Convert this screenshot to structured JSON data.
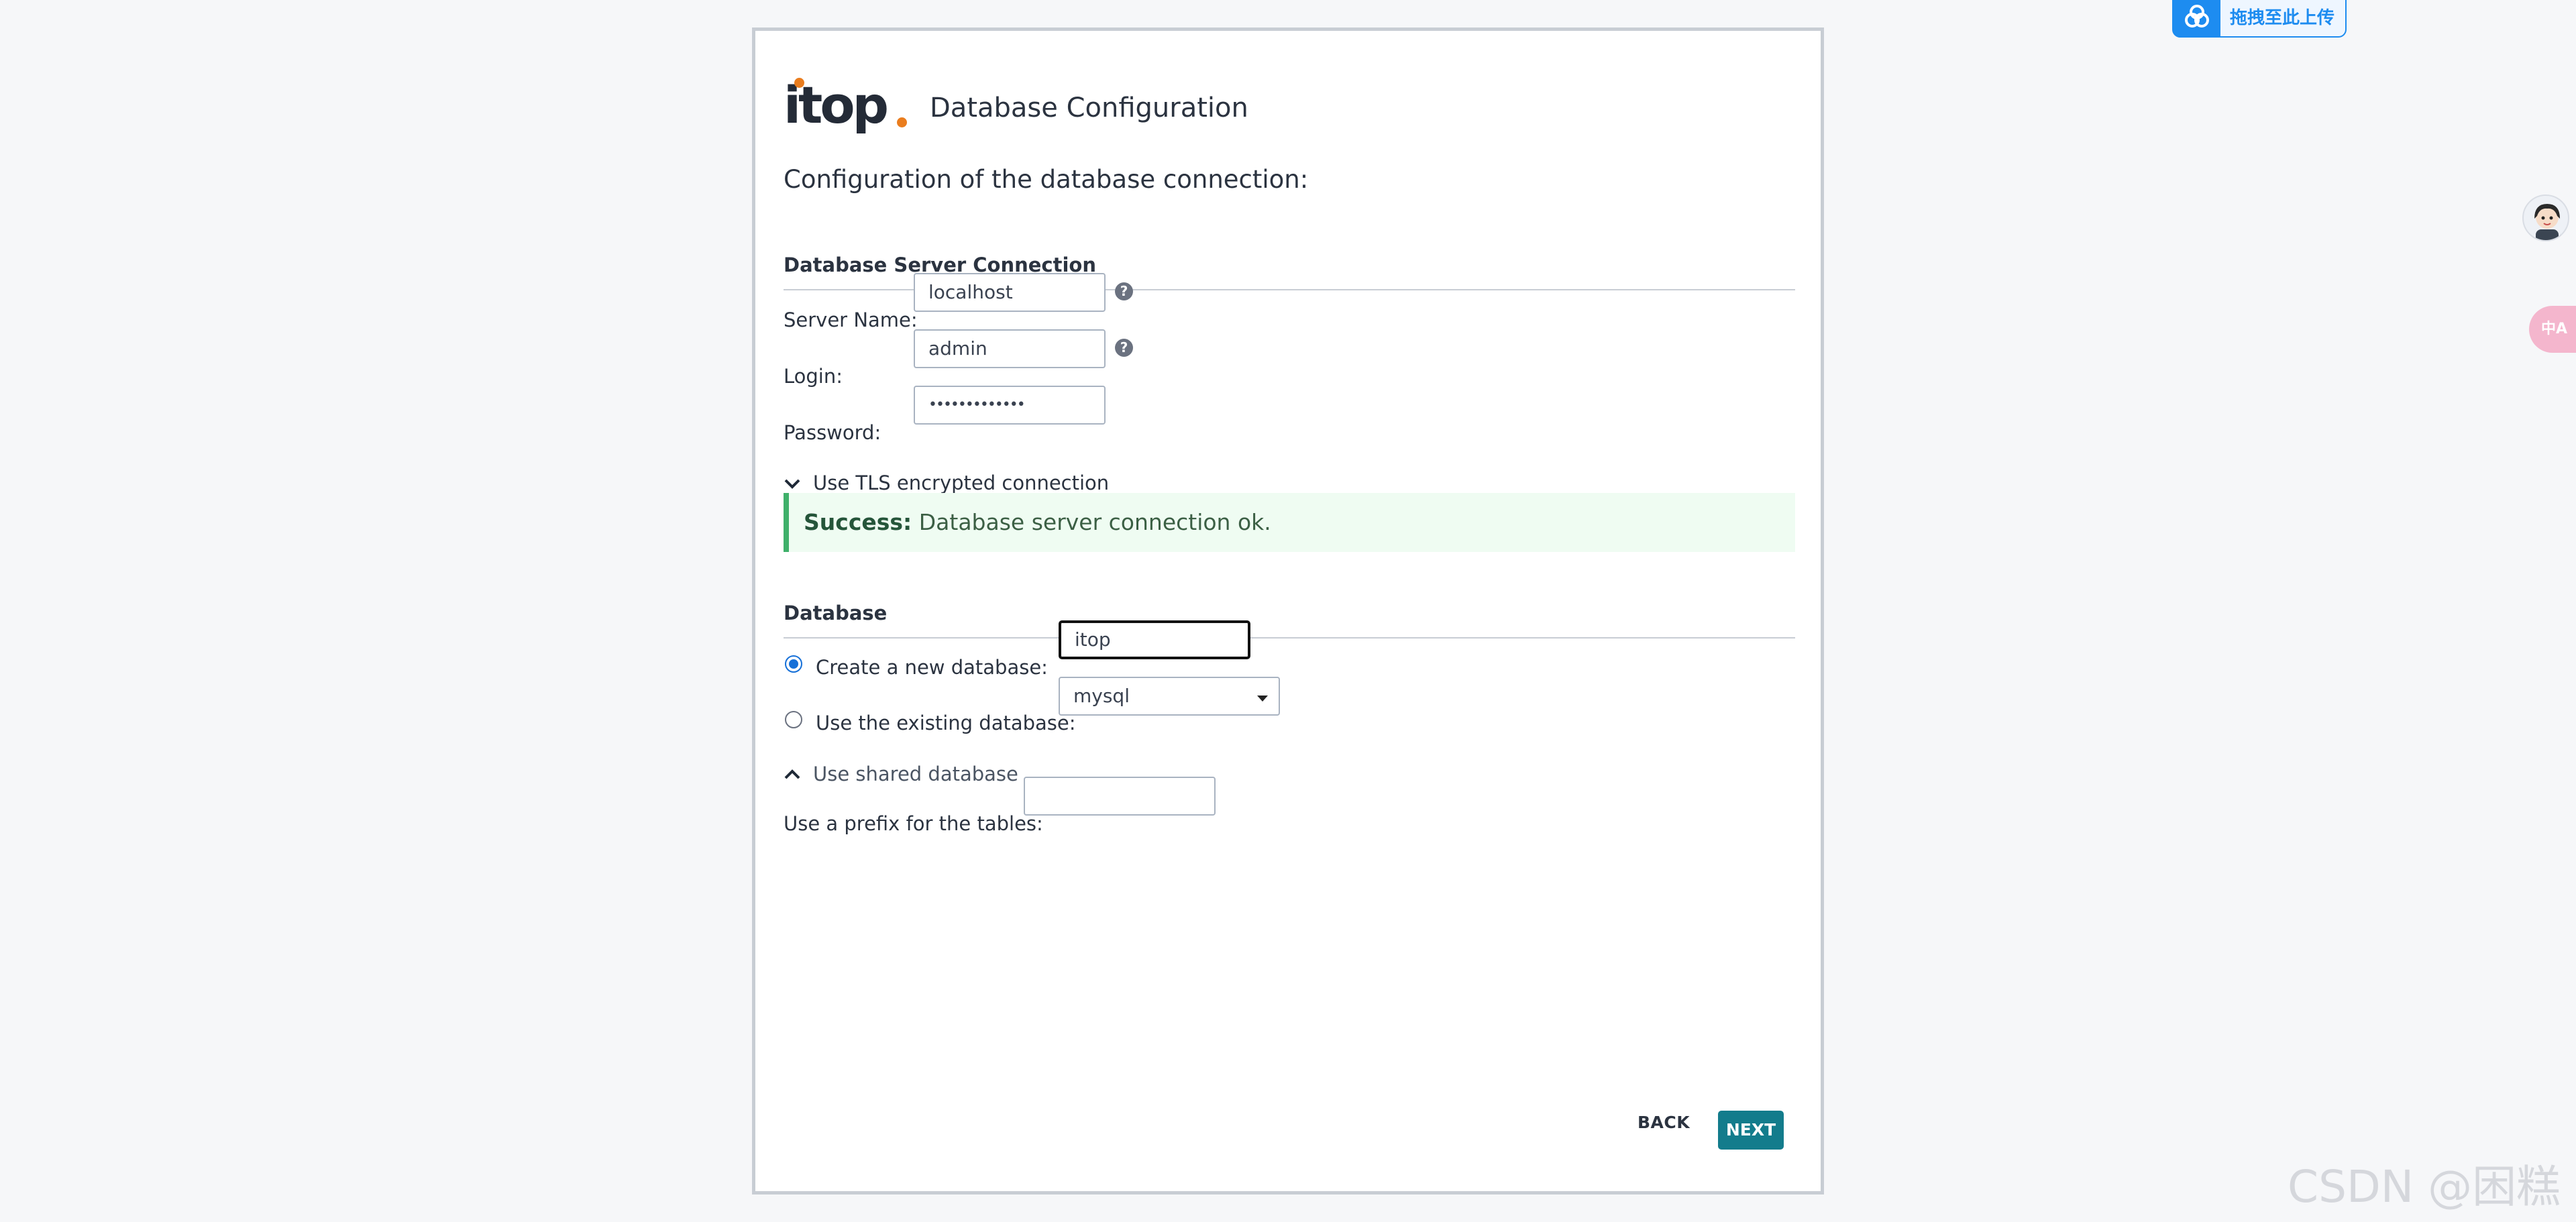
{
  "header": {
    "logo_text": "itop",
    "title": "Database Configuration"
  },
  "subtitle": "Configuration of the database connection:",
  "server_section": {
    "title": "Database Server Connection",
    "server_name_label": "Server Name:",
    "server_name_value": "localhost",
    "login_label": "Login:",
    "login_value": "admin",
    "password_label": "Password:",
    "password_mask": "•••••••••••••",
    "tls_toggle_label": "Use TLS encrypted connection"
  },
  "alert": {
    "status": "Success:",
    "message": "Database server connection ok."
  },
  "database_section": {
    "title": "Database",
    "create_label": "Create a new database:",
    "create_value": "itop",
    "existing_label": "Use the existing database:",
    "existing_selected": "mysql",
    "shared_toggle_label": "Use shared database",
    "prefix_label": "Use a prefix for the tables:",
    "prefix_value": ""
  },
  "buttons": {
    "back": "BACK",
    "next": "NEXT"
  },
  "overlay": {
    "upload_label": "拖拽至此上传",
    "translate_label": "中A",
    "watermark": "CSDN @困糕"
  },
  "colors": {
    "accent_next": "#137c8c",
    "success_border": "#3fb06a",
    "radio_checked": "#1670d8",
    "logo_orange": "#ea7d1e"
  }
}
